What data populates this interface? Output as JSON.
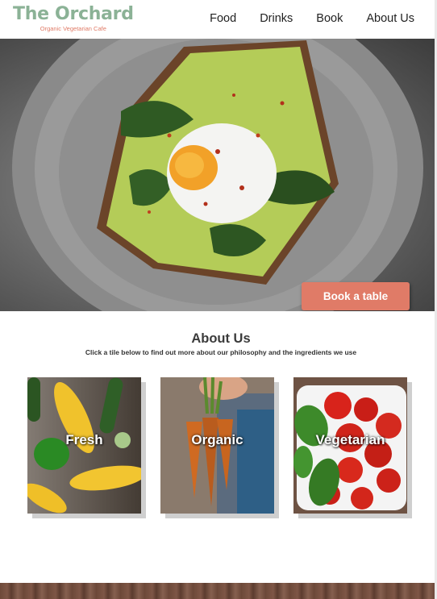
{
  "brand": {
    "title": "The Orchard",
    "subtitle": "Organic Vegetarian Cafe",
    "title_color": "#8bb296",
    "subtitle_color": "#e07b67"
  },
  "nav": {
    "items": [
      {
        "label": "Food"
      },
      {
        "label": "Drinks"
      },
      {
        "label": "Book"
      },
      {
        "label": "About Us"
      }
    ]
  },
  "hero": {
    "image": "avocado-egg-toast-photo",
    "cta_label": "Book a table",
    "cta_color": "#e07b67"
  },
  "about": {
    "heading": "About Us",
    "subheading": "Click a tile below to find out more about our philosophy and the ingredients we use",
    "tiles": [
      {
        "label": "Fresh",
        "image": "corn-and-vegetables-photo"
      },
      {
        "label": "Organic",
        "image": "carrots-in-hand-photo"
      },
      {
        "label": "Vegetarian",
        "image": "tomatoes-and-basil-photo"
      }
    ]
  },
  "footer": {
    "image": "wood-texture-strip"
  }
}
